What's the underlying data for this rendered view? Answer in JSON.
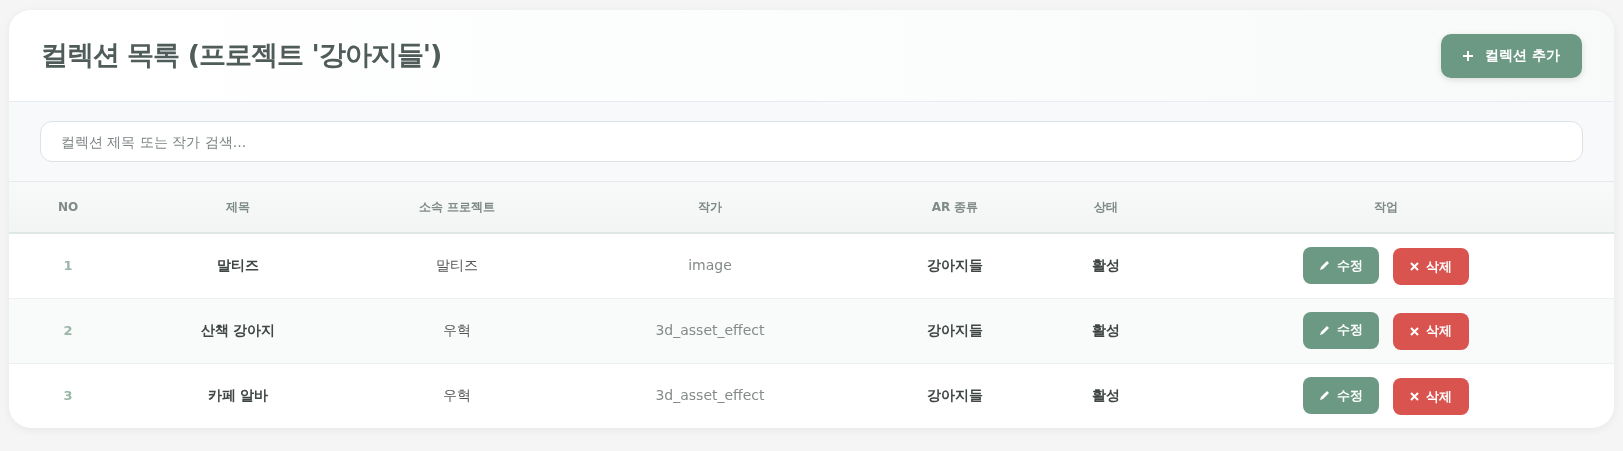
{
  "title": "컬렉션 목록 (프로젝트 '강아지들')",
  "add_button": {
    "label": "컬렉션 추가"
  },
  "search": {
    "placeholder": "컬렉션 제목 또는 작가 검색..."
  },
  "table": {
    "columns": [
      "NO",
      "제목",
      "소속 프로젝트",
      "작가",
      "AR 종류",
      "상태",
      "작업"
    ],
    "rows": [
      {
        "no": "1",
        "title": "말티즈",
        "project": "말티즈",
        "author": "image",
        "ar_type": "강아지들",
        "status": "활성",
        "edit": "수정",
        "delete": "삭제"
      },
      {
        "no": "2",
        "title": "산책 강아지",
        "project": "우혁",
        "author": "3d_asset_effect",
        "ar_type": "강아지들",
        "status": "활성",
        "edit": "수정",
        "delete": "삭제"
      },
      {
        "no": "3",
        "title": "카페 알바",
        "project": "우혁",
        "author": "3d_asset_effect",
        "ar_type": "강아지들",
        "status": "활성",
        "edit": "수정",
        "delete": "삭제"
      }
    ]
  }
}
